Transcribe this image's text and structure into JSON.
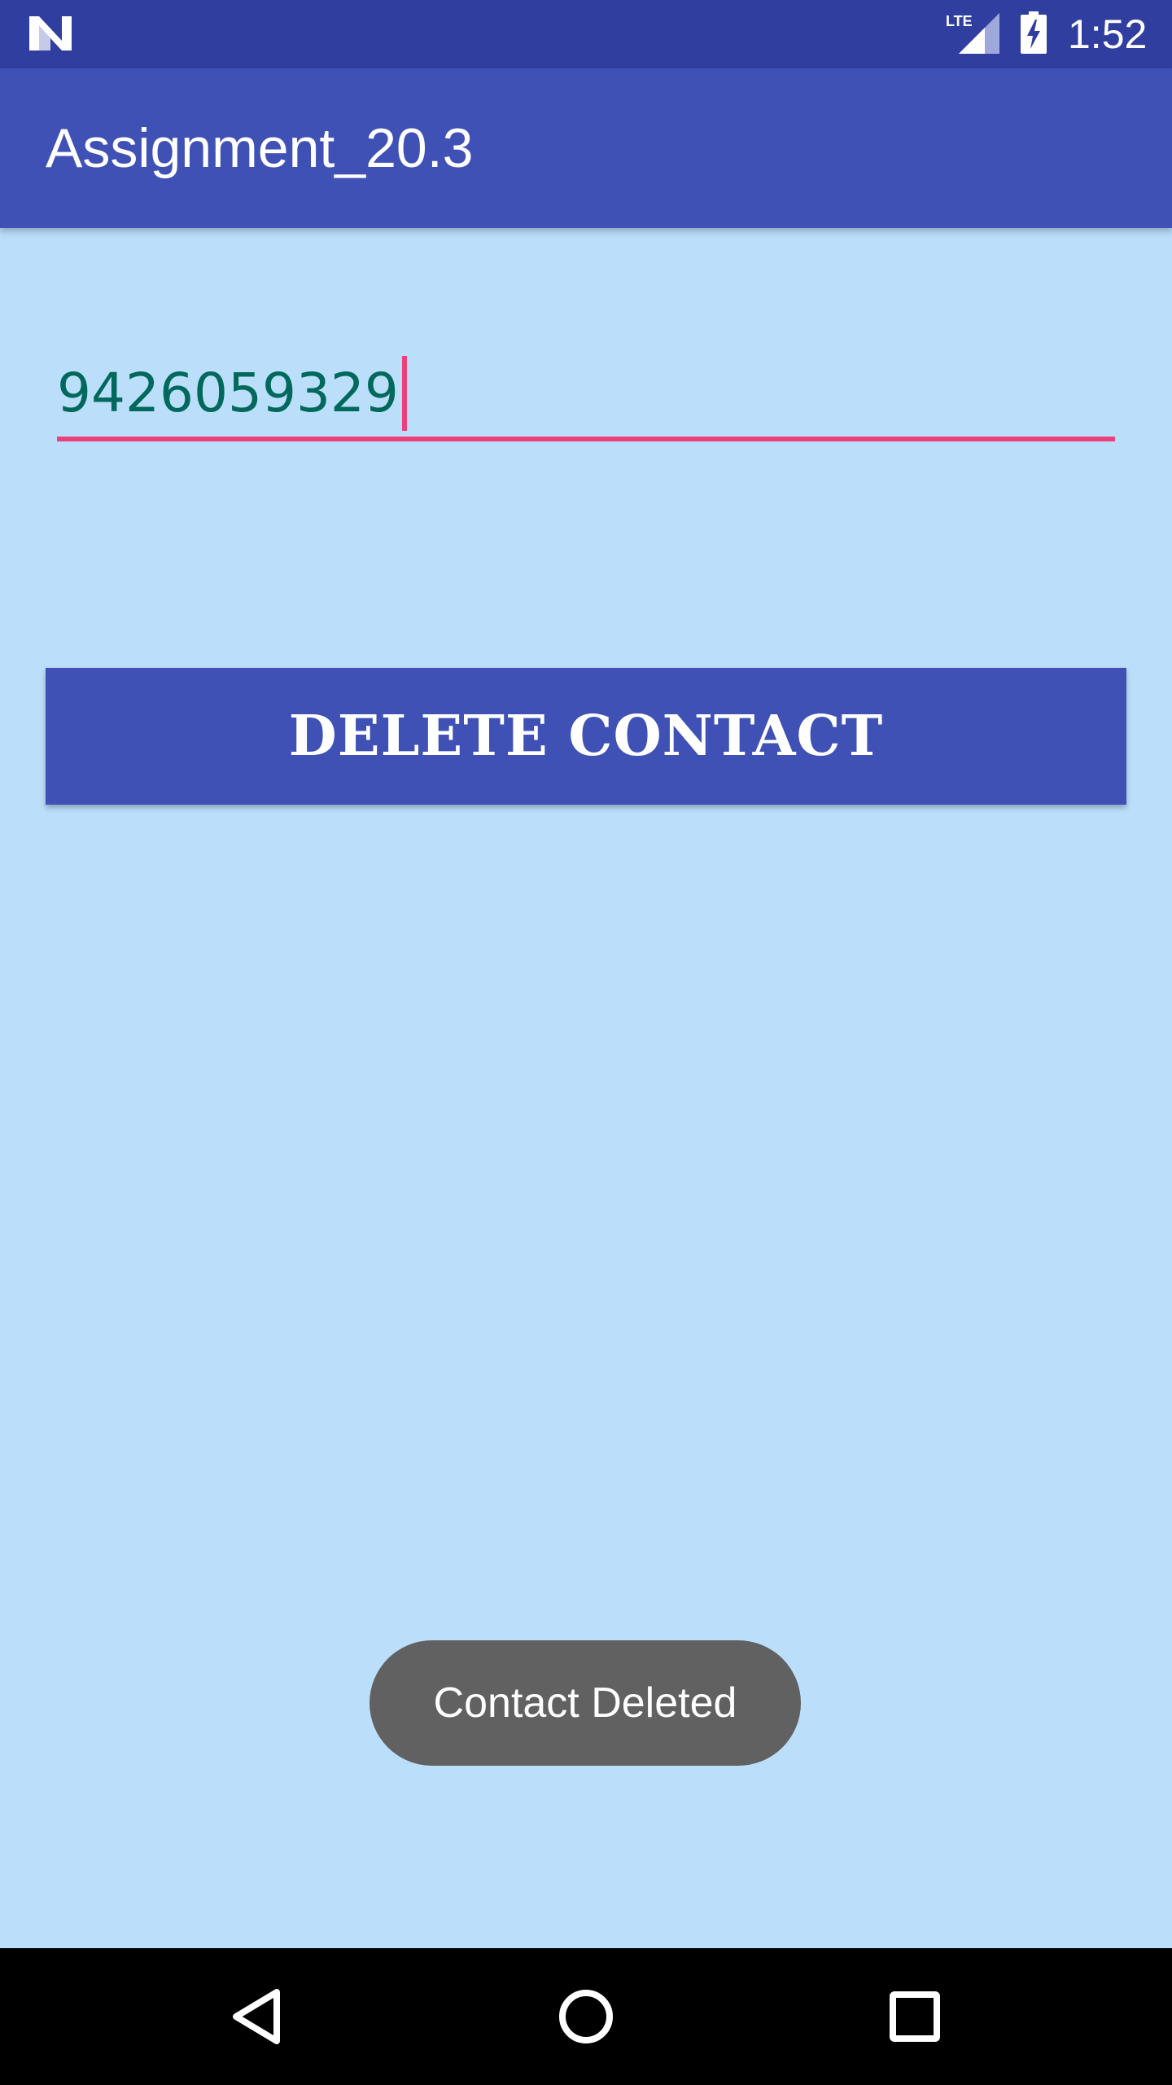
{
  "status_bar": {
    "network": "LTE",
    "time": "1:52"
  },
  "app_bar": {
    "title": "Assignment_20.3"
  },
  "phone_input": {
    "value": "9426059329"
  },
  "delete_button": {
    "label": "DELETE CONTACT"
  },
  "toast": {
    "message": "Contact Deleted"
  },
  "colors": {
    "background": "#bbdefb",
    "status_bar": "#303f9f",
    "primary": "#3f51b5",
    "accent": "#ec407a",
    "input_text": "#00695c",
    "toast": "#616161"
  },
  "icons": {
    "notification": "n-logo-icon",
    "signal": "lte-signal-icon",
    "battery": "battery-charging-icon",
    "nav_back": "back-triangle-icon",
    "nav_home": "home-circle-icon",
    "nav_recents": "recents-square-icon"
  }
}
